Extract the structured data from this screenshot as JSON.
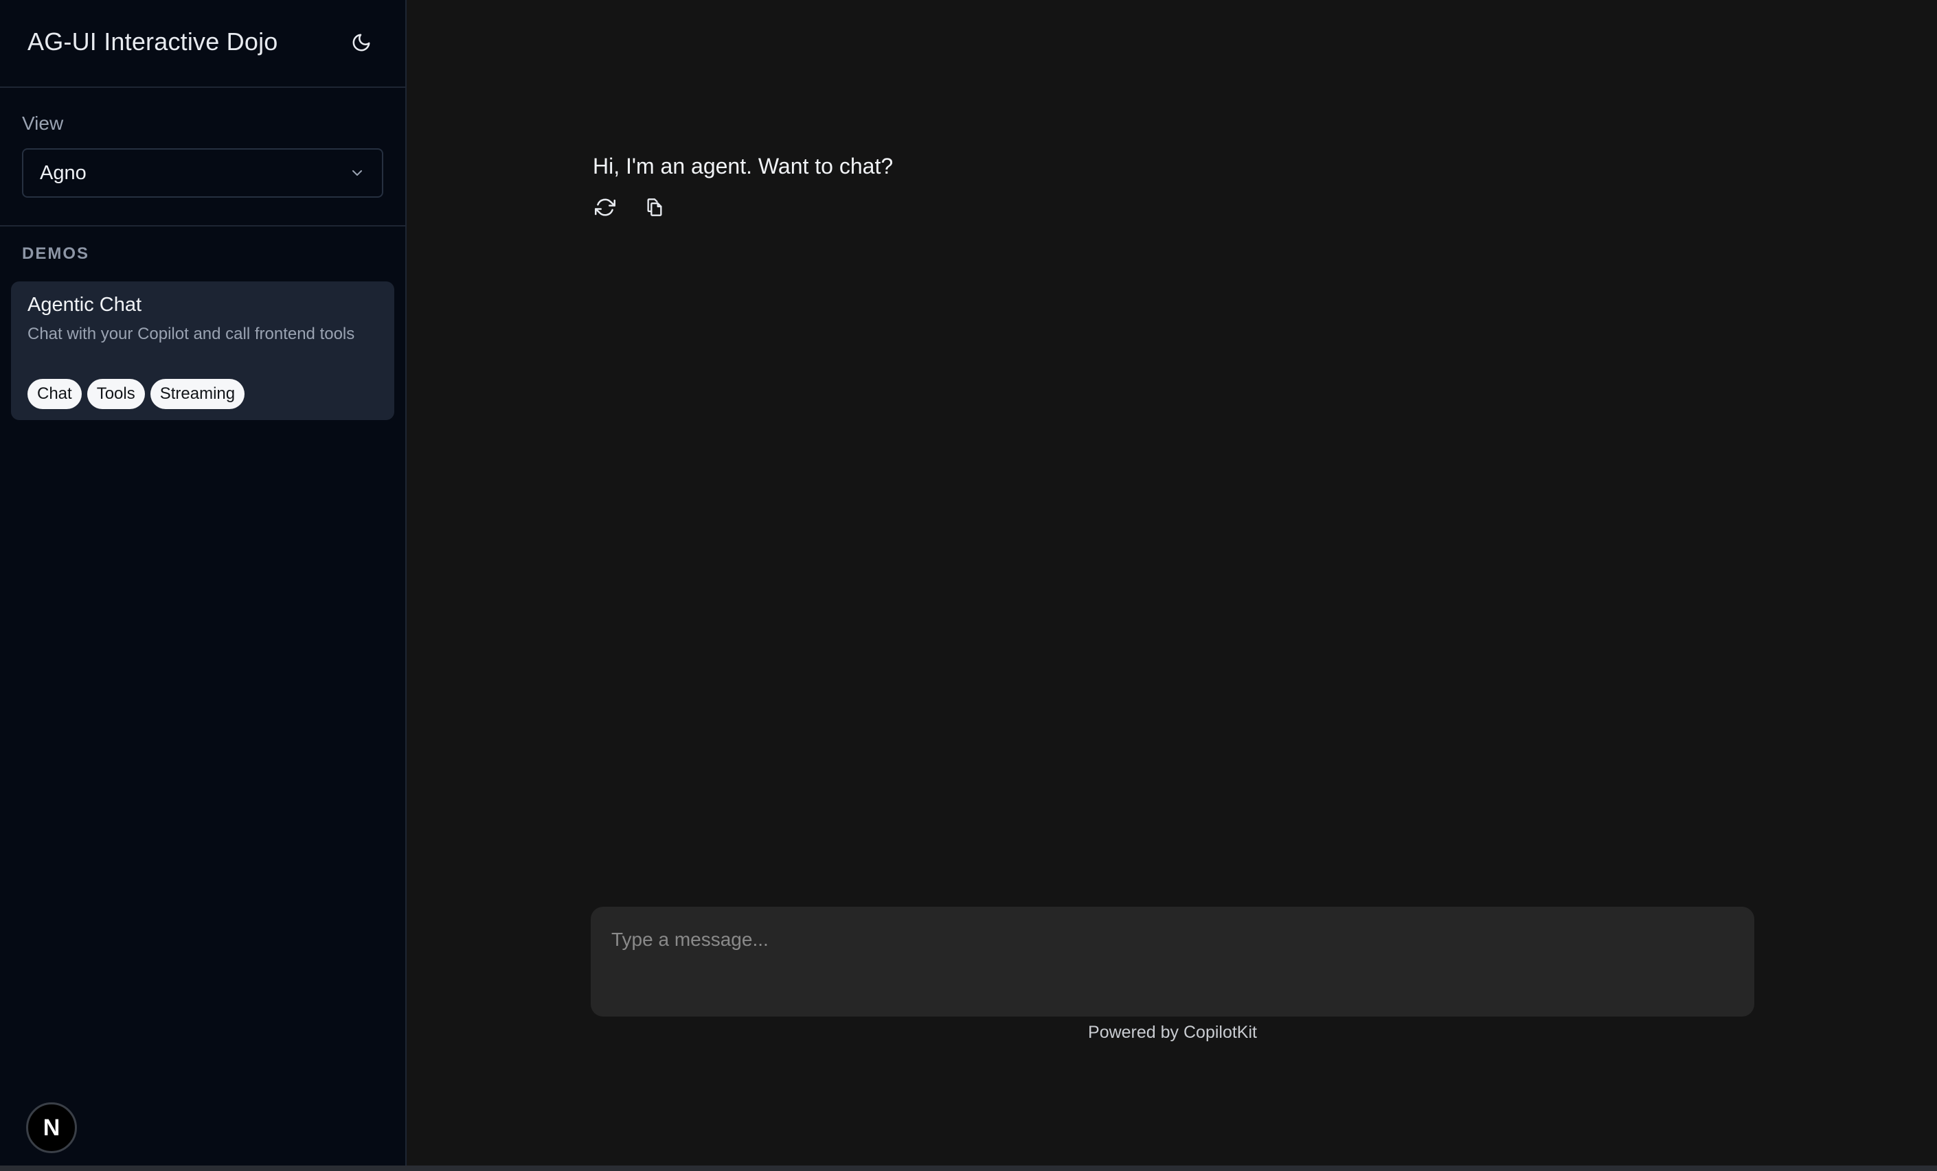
{
  "sidebar": {
    "title": "AG-UI Interactive Dojo",
    "theme_toggle_icon": "moon-icon",
    "view": {
      "label": "View",
      "selected": "Agno"
    },
    "demos_label": "DEMOS",
    "demos": [
      {
        "title": "Agentic Chat",
        "description": "Chat with your Copilot and call frontend tools",
        "tags": [
          "Chat",
          "Tools",
          "Streaming"
        ],
        "selected": true
      }
    ],
    "badge_letter": "N"
  },
  "chat": {
    "messages": [
      {
        "role": "assistant",
        "text": "Hi, I'm an agent. Want to chat?",
        "actions": [
          "regenerate-icon",
          "copy-icon"
        ]
      }
    ],
    "input": {
      "value": "",
      "placeholder": "Type a message..."
    },
    "footer": "Powered by CopilotKit"
  },
  "colors": {
    "sidebar_bg": "#050a14",
    "main_bg": "#141414",
    "card_bg": "#1c2433",
    "composer_bg": "#262626"
  }
}
